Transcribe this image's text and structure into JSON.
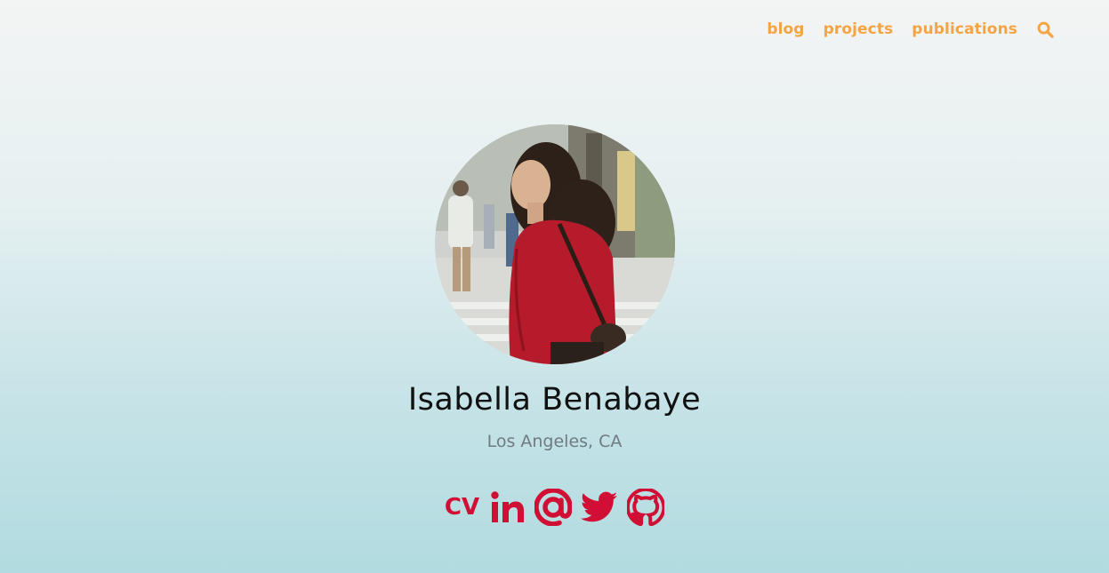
{
  "nav": {
    "items": [
      {
        "label": "blog"
      },
      {
        "label": "projects"
      },
      {
        "label": "publications"
      }
    ],
    "search_icon": "search-icon",
    "link_color": "#f5a443"
  },
  "profile": {
    "name": "Isabella Benabaye",
    "location": "Los Angeles, CA",
    "avatar_icon": "profile-photo"
  },
  "socials": {
    "cv_label": "CV",
    "icons": [
      "linkedin-icon",
      "email-icon",
      "twitter-icon",
      "github-icon"
    ],
    "color": "#d10f35"
  }
}
